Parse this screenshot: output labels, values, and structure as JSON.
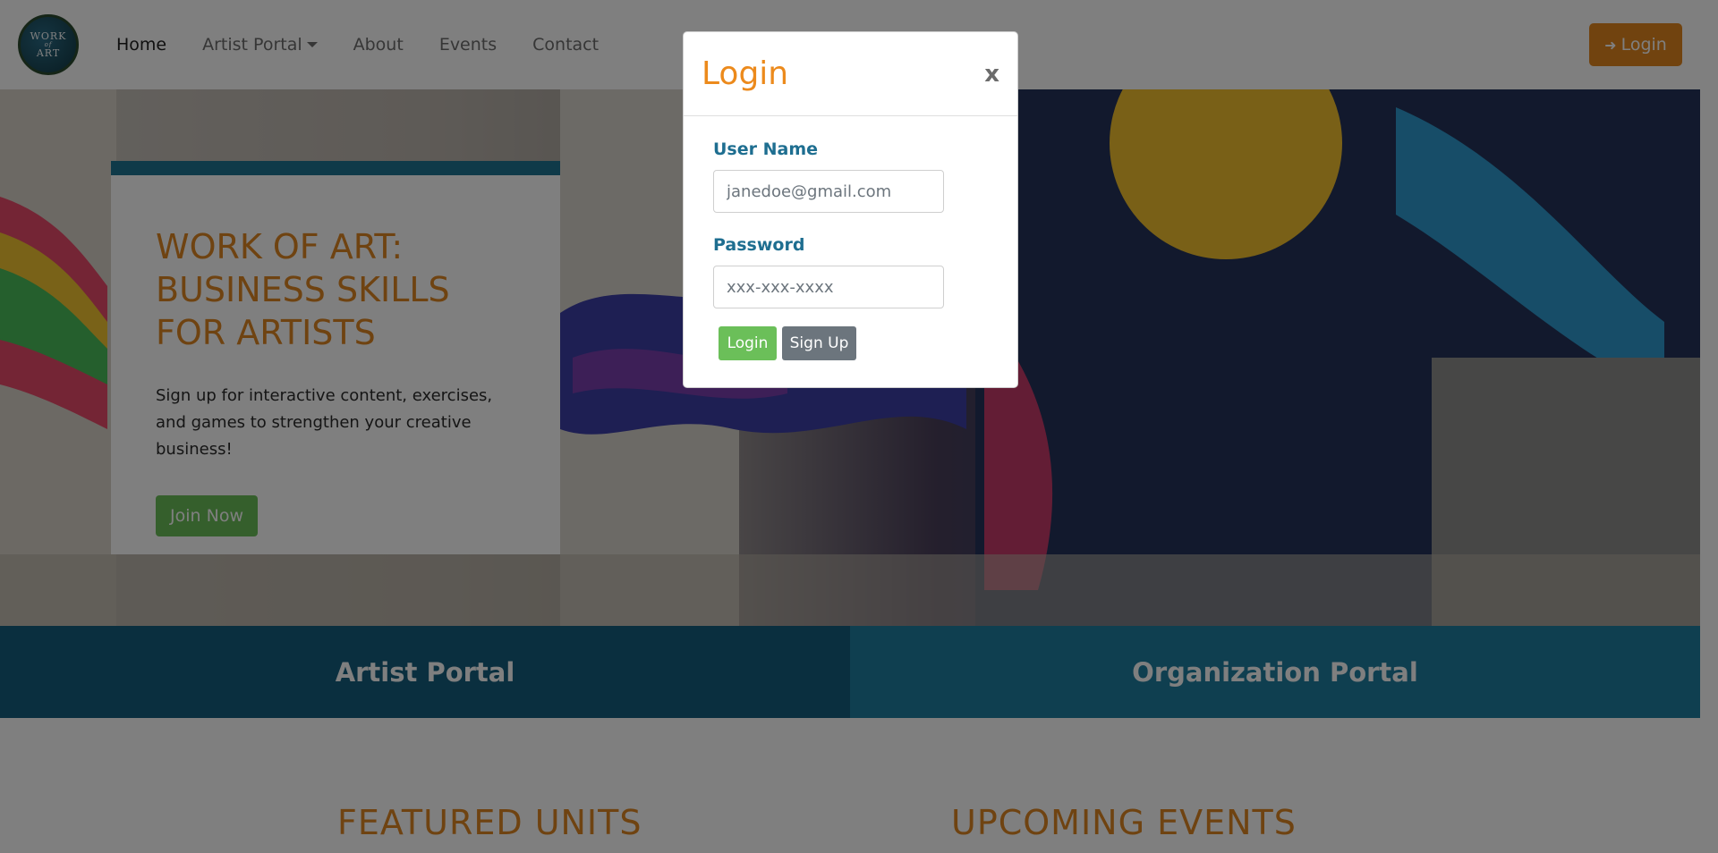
{
  "brand": {
    "logo_line1": "WORK",
    "logo_line2": "of",
    "logo_line3": "ART"
  },
  "nav": {
    "items": [
      {
        "label": "Home"
      },
      {
        "label": "Artist Portal"
      },
      {
        "label": "About"
      },
      {
        "label": "Events"
      },
      {
        "label": "Contact"
      }
    ],
    "login_label": "Login"
  },
  "hero": {
    "title": "WORK OF ART: BUSINESS SKILLS FOR ARTISTS",
    "text": "Sign up for interactive content, exercises, and games to strengthen your creative business!",
    "cta_label": "Join Now"
  },
  "portals": {
    "artist": "Artist Portal",
    "organization": "Organization Portal"
  },
  "sections": {
    "featured": "FEATURED UNITS",
    "events": "UPCOMING EVENTS"
  },
  "modal": {
    "title": "Login",
    "close": "x",
    "username_label": "User Name",
    "username_placeholder": "janedoe@gmail.com",
    "password_label": "Password",
    "password_placeholder": "xxx-xxx-xxxx",
    "login_button": "Login",
    "signup_button": "Sign Up"
  },
  "colors": {
    "accent_orange": "#df8622",
    "teal": "#1e7592",
    "green": "#6bbf59",
    "gray_button": "#6c757d"
  }
}
